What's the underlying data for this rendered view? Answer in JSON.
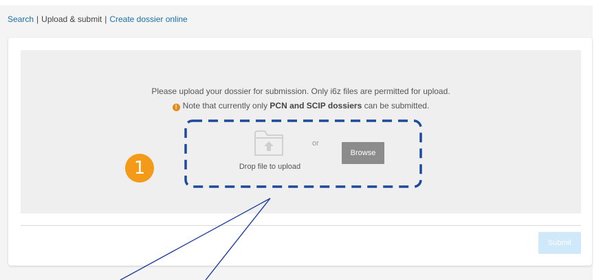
{
  "breadcrumb": {
    "search": "Search",
    "separator": "|",
    "upload_submit": "Upload & submit",
    "create_dossier": "Create dossier online"
  },
  "upload": {
    "message": "Please upload your dossier for submission. Only i6z files are permitted for upload.",
    "note_prefix": "Note that currently only",
    "note_strong": "PCN and SCIP dossiers",
    "note_suffix": "can be submitted.",
    "drop_label": "Drop file to upload",
    "or_label": "or",
    "browse_label": "Browse",
    "folder_icon": "folder-upload-icon",
    "warning_icon": "exclamation-circle-icon"
  },
  "submit_label": "Submit",
  "annotation": {
    "step_number": "1"
  },
  "colors": {
    "link": "#1a6fa8",
    "warning": "#e48a1b",
    "step_badge": "#f49a19",
    "dashed_outline": "#1d4a9c",
    "browse_bg": "#8c8c8c",
    "submit_bg_disabled": "#cfe9fb"
  }
}
